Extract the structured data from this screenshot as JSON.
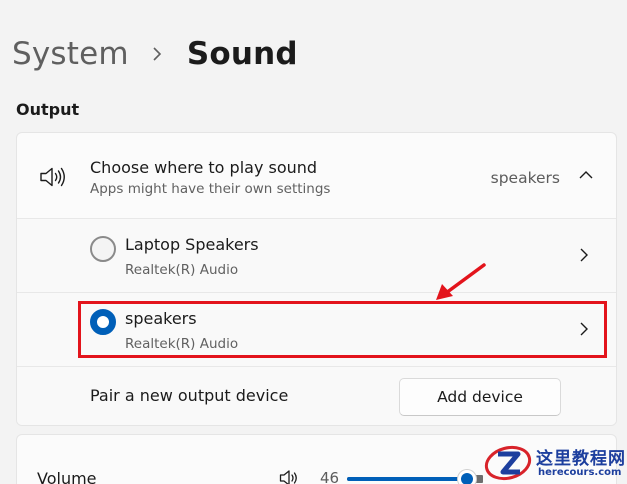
{
  "breadcrumb": {
    "parent": "System",
    "current": "Sound"
  },
  "output": {
    "section_label": "Output",
    "header": {
      "title": "Choose where to play sound",
      "subtitle": "Apps might have their own settings",
      "value": "speakers"
    },
    "devices": [
      {
        "name": "Laptop Speakers",
        "driver": "Realtek(R) Audio",
        "selected": false
      },
      {
        "name": "speakers",
        "driver": "Realtek(R) Audio",
        "selected": true
      }
    ],
    "pair": {
      "label": "Pair a new output device",
      "button": "Add device"
    }
  },
  "volume": {
    "label": "Volume",
    "value": "46",
    "level_percent": 88
  },
  "watermark": {
    "cn": "这里教程网",
    "url": "herecours.com"
  },
  "colors": {
    "accent": "#005fb8",
    "annotation": "#e3141c",
    "watermark": "#1d3f9e"
  },
  "icons": {
    "breadcrumb_separator": "chevron-right-icon",
    "output_header": "speaker-icon",
    "expand_toggle": "chevron-up-icon",
    "device_row": "chevron-right-icon",
    "volume": "speaker-icon"
  }
}
